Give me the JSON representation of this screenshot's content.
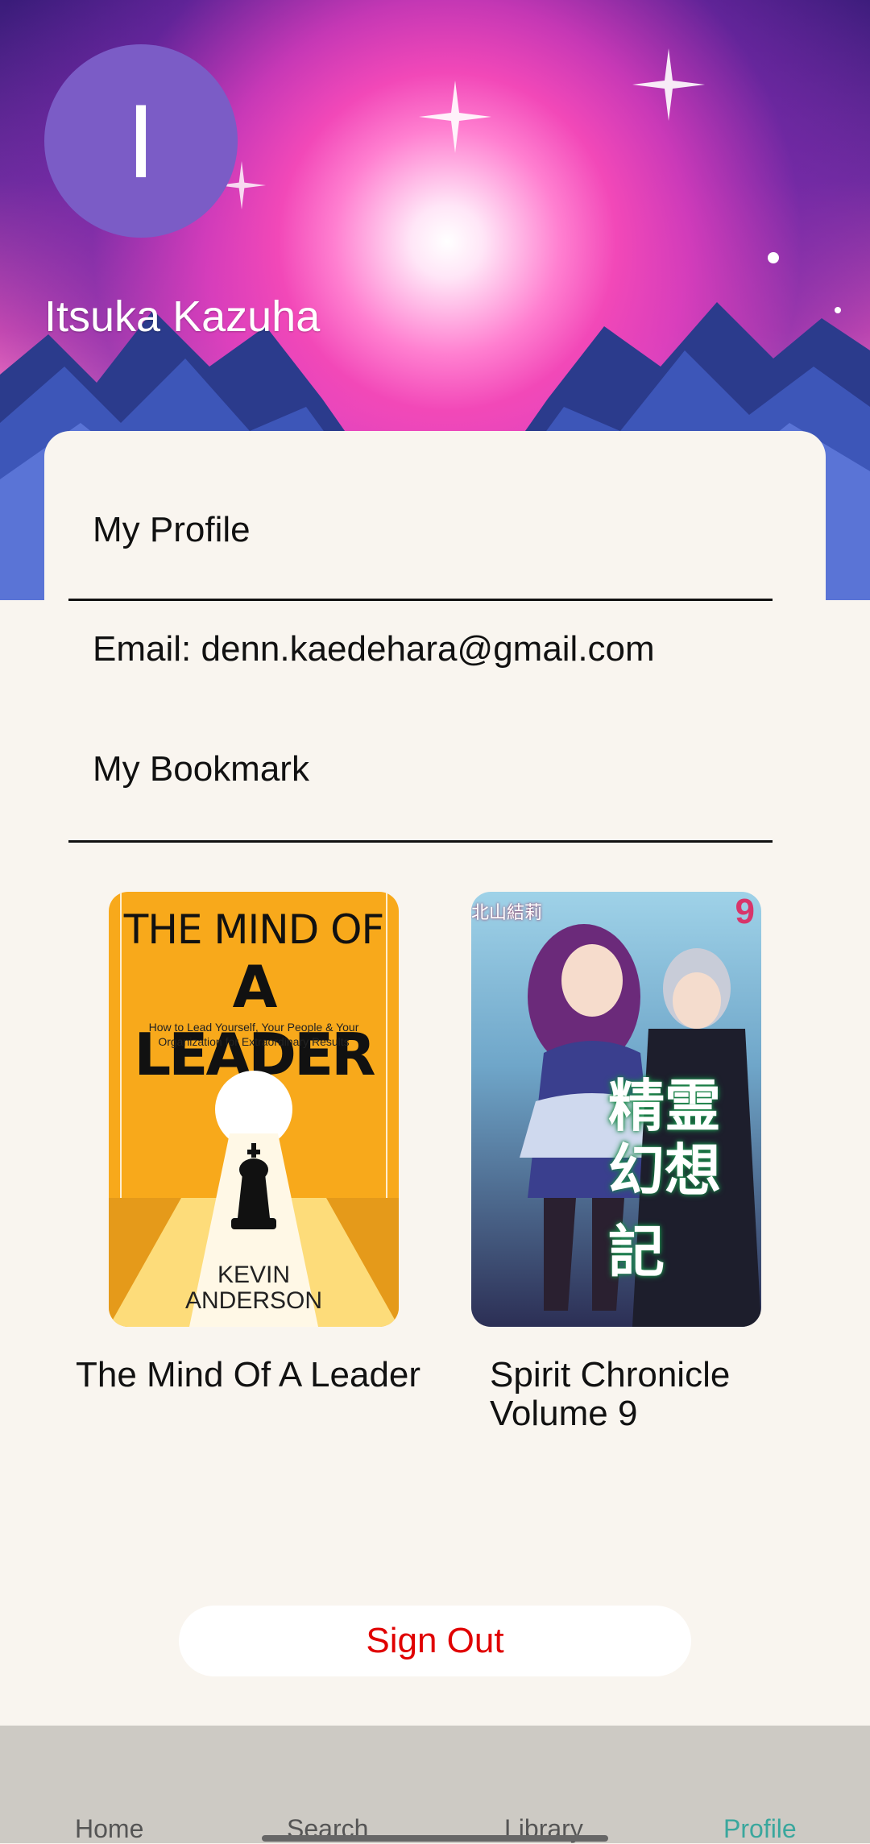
{
  "profile": {
    "avatar_initial": "I",
    "name": "Itsuka Kazuha",
    "section_title": "My Profile",
    "email_text": "Email: denn.kaedehara@gmail.com"
  },
  "bookmarks": {
    "section_title": "My Bookmark",
    "items": [
      {
        "title": "The Mind Of A Leader",
        "cover_heading_1": "THE MIND OF",
        "cover_heading_2": "A LEADER",
        "cover_subtitle_1": "How to Lead Yourself, Your People & Your",
        "cover_subtitle_2": "Organization for Extraordinary Results",
        "cover_author_1": "KEVIN",
        "cover_author_2": "ANDERSON"
      },
      {
        "title": "Spirit Chronicle Volume 9",
        "cover_title_jp_1": "精霊",
        "cover_title_jp_2": "幻想記",
        "cover_author_jp": "北山結莉",
        "cover_volume": "9"
      }
    ]
  },
  "actions": {
    "sign_out": "Sign Out"
  },
  "nav": {
    "items": [
      {
        "label": "Home"
      },
      {
        "label": "Search"
      },
      {
        "label": "Library"
      },
      {
        "label": "Profile"
      }
    ],
    "active_index": 3,
    "active_color": "#3aa79d"
  },
  "colors": {
    "avatar_bg": "#7b5cc6",
    "sign_out_text": "#e00000",
    "page_bg": "#f9f5ef",
    "navbar_bg": "#cdcac4"
  }
}
